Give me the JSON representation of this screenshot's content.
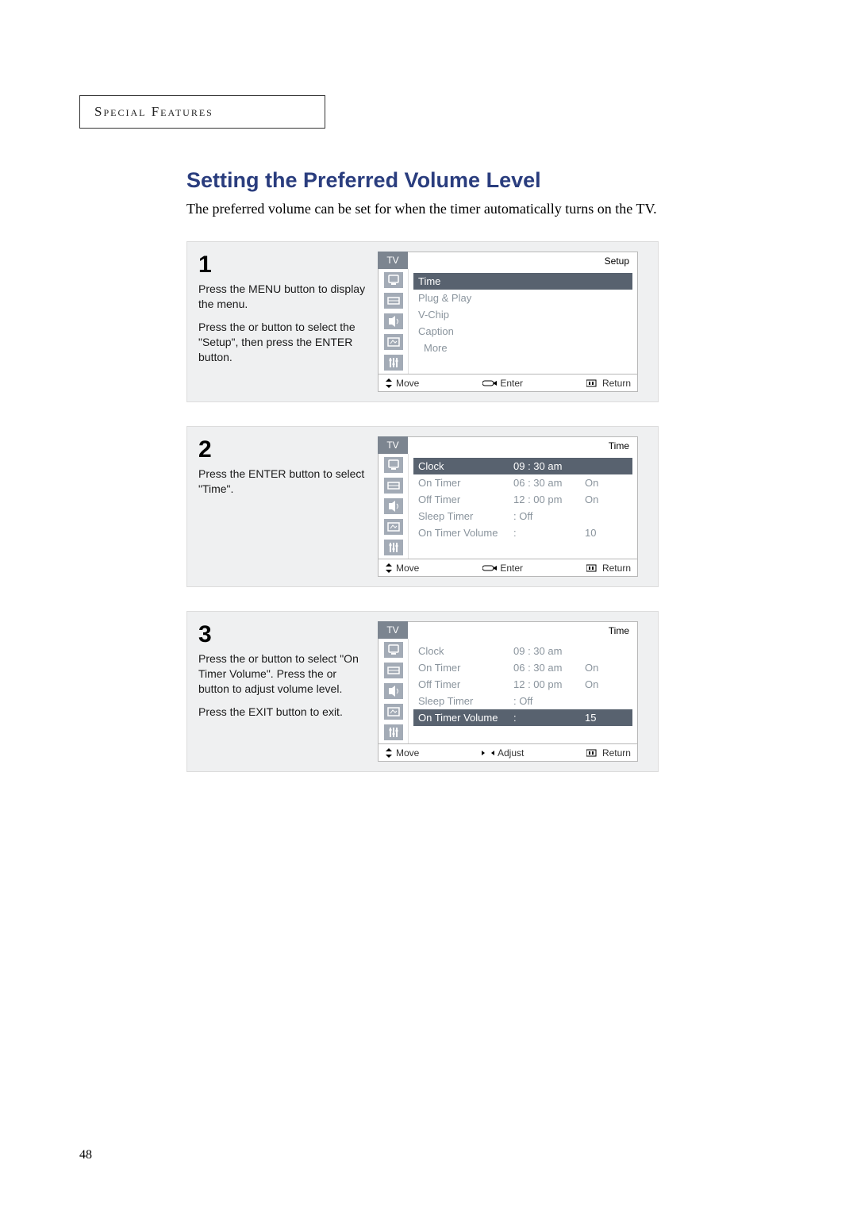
{
  "header": "Special Features",
  "title": "Setting the Preferred Volume Level",
  "description": "The preferred volume can be set for when the timer automatically turns on the TV.",
  "page_number": "48",
  "steps": [
    {
      "num": "1",
      "text1": "Press the MENU button to display the menu.",
      "text2": "Press the  or  button to select the \"Setup\", then press the ENTER button.",
      "osd_header_left": "TV",
      "osd_header_right": "Setup",
      "selected": "Time",
      "items": [
        {
          "label": "Time",
          "value": "",
          "status": ""
        },
        {
          "label": "Plug & Play",
          "value": "",
          "status": ""
        },
        {
          "label": "V-Chip",
          "value": "",
          "status": ""
        },
        {
          "label": "Caption",
          "value": "",
          "status": ""
        },
        {
          "label": "More",
          "value": "",
          "status": "",
          "center": true
        }
      ],
      "footer": {
        "move": "Move",
        "mid": "Enter",
        "return": "Return"
      }
    },
    {
      "num": "2",
      "text1": "Press the ENTER button to select \"Time\".",
      "text2": "",
      "osd_header_left": "TV",
      "osd_header_right": "Time",
      "selected": "Clock",
      "items": [
        {
          "label": "Clock",
          "value": "09 : 30 am",
          "status": ""
        },
        {
          "label": "On Timer",
          "value": "06 : 30 am",
          "status": "On"
        },
        {
          "label": "Off Timer",
          "value": "12 : 00 pm",
          "status": "On"
        },
        {
          "label": "Sleep Timer",
          "value": ": Off",
          "status": ""
        },
        {
          "label": "On Timer Volume",
          "value": ":",
          "status": "10"
        }
      ],
      "footer": {
        "move": "Move",
        "mid": "Enter",
        "return": "Return"
      }
    },
    {
      "num": "3",
      "text1": "Press the  or  button to select \"On Timer Volume\". Press the  or  button to adjust volume level.",
      "text2": "Press the EXIT button to exit.",
      "osd_header_left": "TV",
      "osd_header_right": "Time",
      "selected": "On Timer Volume",
      "items": [
        {
          "label": "Clock",
          "value": "09 : 30 am",
          "status": ""
        },
        {
          "label": "On Timer",
          "value": "06 : 30 am",
          "status": "On"
        },
        {
          "label": "Off Timer",
          "value": "12 : 00 pm",
          "status": "On"
        },
        {
          "label": "Sleep Timer",
          "value": ": Off",
          "status": ""
        },
        {
          "label": "On Timer Volume",
          "value": ":",
          "status": "15"
        }
      ],
      "footer": {
        "move": "Move",
        "mid": "Adjust",
        "return": "Return"
      }
    }
  ]
}
